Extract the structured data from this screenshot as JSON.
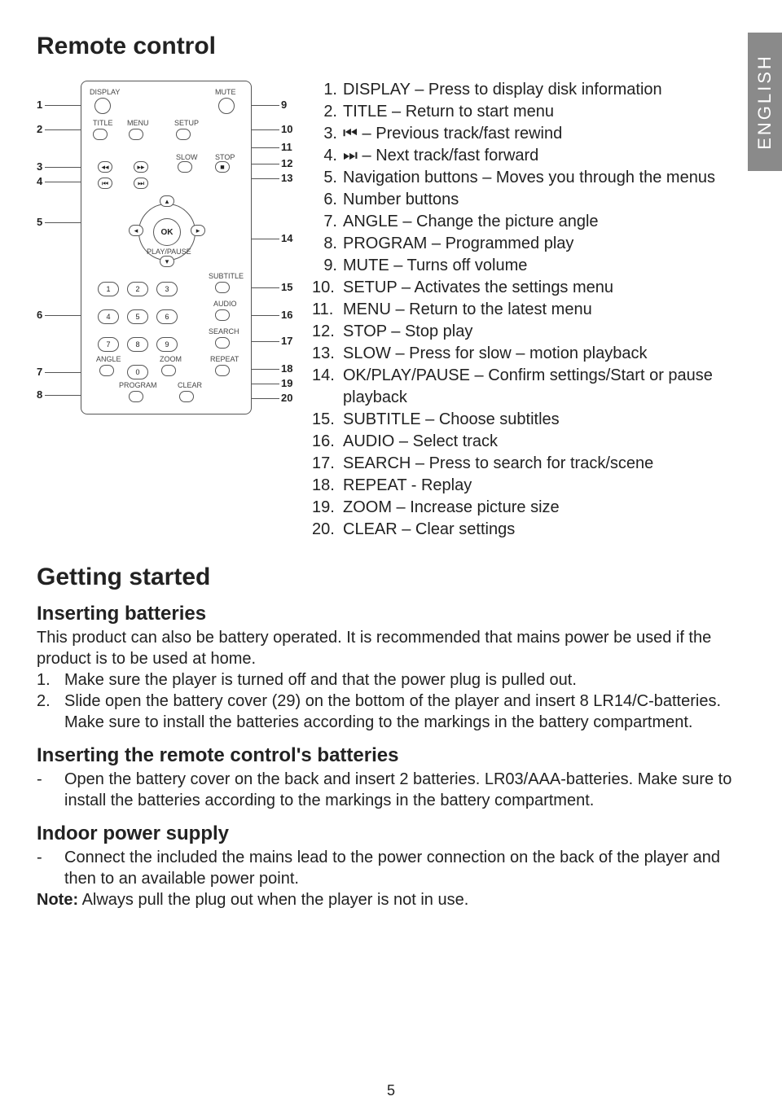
{
  "language_tab": "ENGLISH",
  "headings": {
    "remote": "Remote control",
    "getting_started": "Getting started",
    "inserting_batteries": "Inserting batteries",
    "inserting_remote_batteries": "Inserting the remote control's batteries",
    "indoor_power": "Indoor power supply"
  },
  "remote_labels": {
    "display": "DISPLAY",
    "mute": "MUTE",
    "title": "TITLE",
    "menu": "MENU",
    "setup": "SETUP",
    "slow": "SLOW",
    "stop": "STOP",
    "ok": "OK",
    "play_pause": "PLAY/PAUSE",
    "subtitle": "SUBTITLE",
    "audio": "AUDIO",
    "search": "SEARCH",
    "angle": "ANGLE",
    "zoom": "ZOOM",
    "repeat": "REPEAT",
    "program": "PROGRAM",
    "clear": "CLEAR",
    "n1": "1",
    "n2": "2",
    "n3": "3",
    "n4": "4",
    "n5": "5",
    "n6": "6",
    "n7": "7",
    "n8": "8",
    "n9": "9",
    "n0": "0"
  },
  "callouts_left": [
    "1",
    "2",
    "3",
    "4",
    "5",
    "6",
    "7",
    "8"
  ],
  "callouts_right": [
    "9",
    "10",
    "11",
    "12",
    "13",
    "14",
    "15",
    "16",
    "17",
    "18",
    "19",
    "20"
  ],
  "legend": [
    {
      "n": "1.",
      "t": "DISPLAY – Press to display disk information"
    },
    {
      "n": "2.",
      "t": "TITLE – Return to start menu"
    },
    {
      "n": "3.",
      "t": "⏮ – Previous track/fast rewind"
    },
    {
      "n": "4.",
      "t": "⏭ – Next track/fast forward"
    },
    {
      "n": "5.",
      "t": "Navigation buttons – Moves you through the menus"
    },
    {
      "n": "6.",
      "t": "Number buttons"
    },
    {
      "n": "7.",
      "t": "ANGLE – Change the picture angle"
    },
    {
      "n": "8.",
      "t": "PROGRAM – Programmed play"
    },
    {
      "n": "9.",
      "t": "MUTE – Turns off volume"
    },
    {
      "n": "10.",
      "t": "SETUP – Activates the settings menu"
    },
    {
      "n": "11.",
      "t": "MENU – Return to the latest menu"
    },
    {
      "n": "12.",
      "t": "STOP – Stop play"
    },
    {
      "n": "13.",
      "t": "SLOW – Press for slow – motion playback"
    },
    {
      "n": "14.",
      "t": "OK/PLAY/PAUSE – Confirm settings/Start or pause playback"
    },
    {
      "n": "15.",
      "t": "SUBTITLE – Choose subtitles"
    },
    {
      "n": "16.",
      "t": "AUDIO – Select track"
    },
    {
      "n": "17.",
      "t": "SEARCH – Press to search for track/scene"
    },
    {
      "n": "18.",
      "t": "REPEAT -  Replay"
    },
    {
      "n": "19.",
      "t": "ZOOM – Increase picture size"
    },
    {
      "n": "20.",
      "t": "CLEAR – Clear settings"
    }
  ],
  "batteries_intro": "This product can also be battery operated. It is recommended that mains power be used if the product is to be used at home.",
  "batteries_steps": [
    {
      "m": "1.",
      "c": "Make sure the player is turned off and that the power plug is pulled out."
    },
    {
      "m": "2.",
      "c": "Slide open the battery cover (29) on the bottom of the player and insert 8 LR14/C-batteries. Make sure to install the batteries according to the markings in the battery compartment."
    }
  ],
  "remote_batteries": [
    {
      "m": "-",
      "c": "Open the battery cover on the back and insert 2 batteries. LR03/AAA-batteries. Make sure to install the batteries according to the markings in the battery compartment."
    }
  ],
  "indoor_power": [
    {
      "m": "-",
      "c": "Connect the included the mains lead to the power connection on the back of the player and then to an available power point."
    }
  ],
  "indoor_note_label": "Note:",
  "indoor_note_text": " Always pull the plug out when the player is not in use.",
  "page_number": "5"
}
